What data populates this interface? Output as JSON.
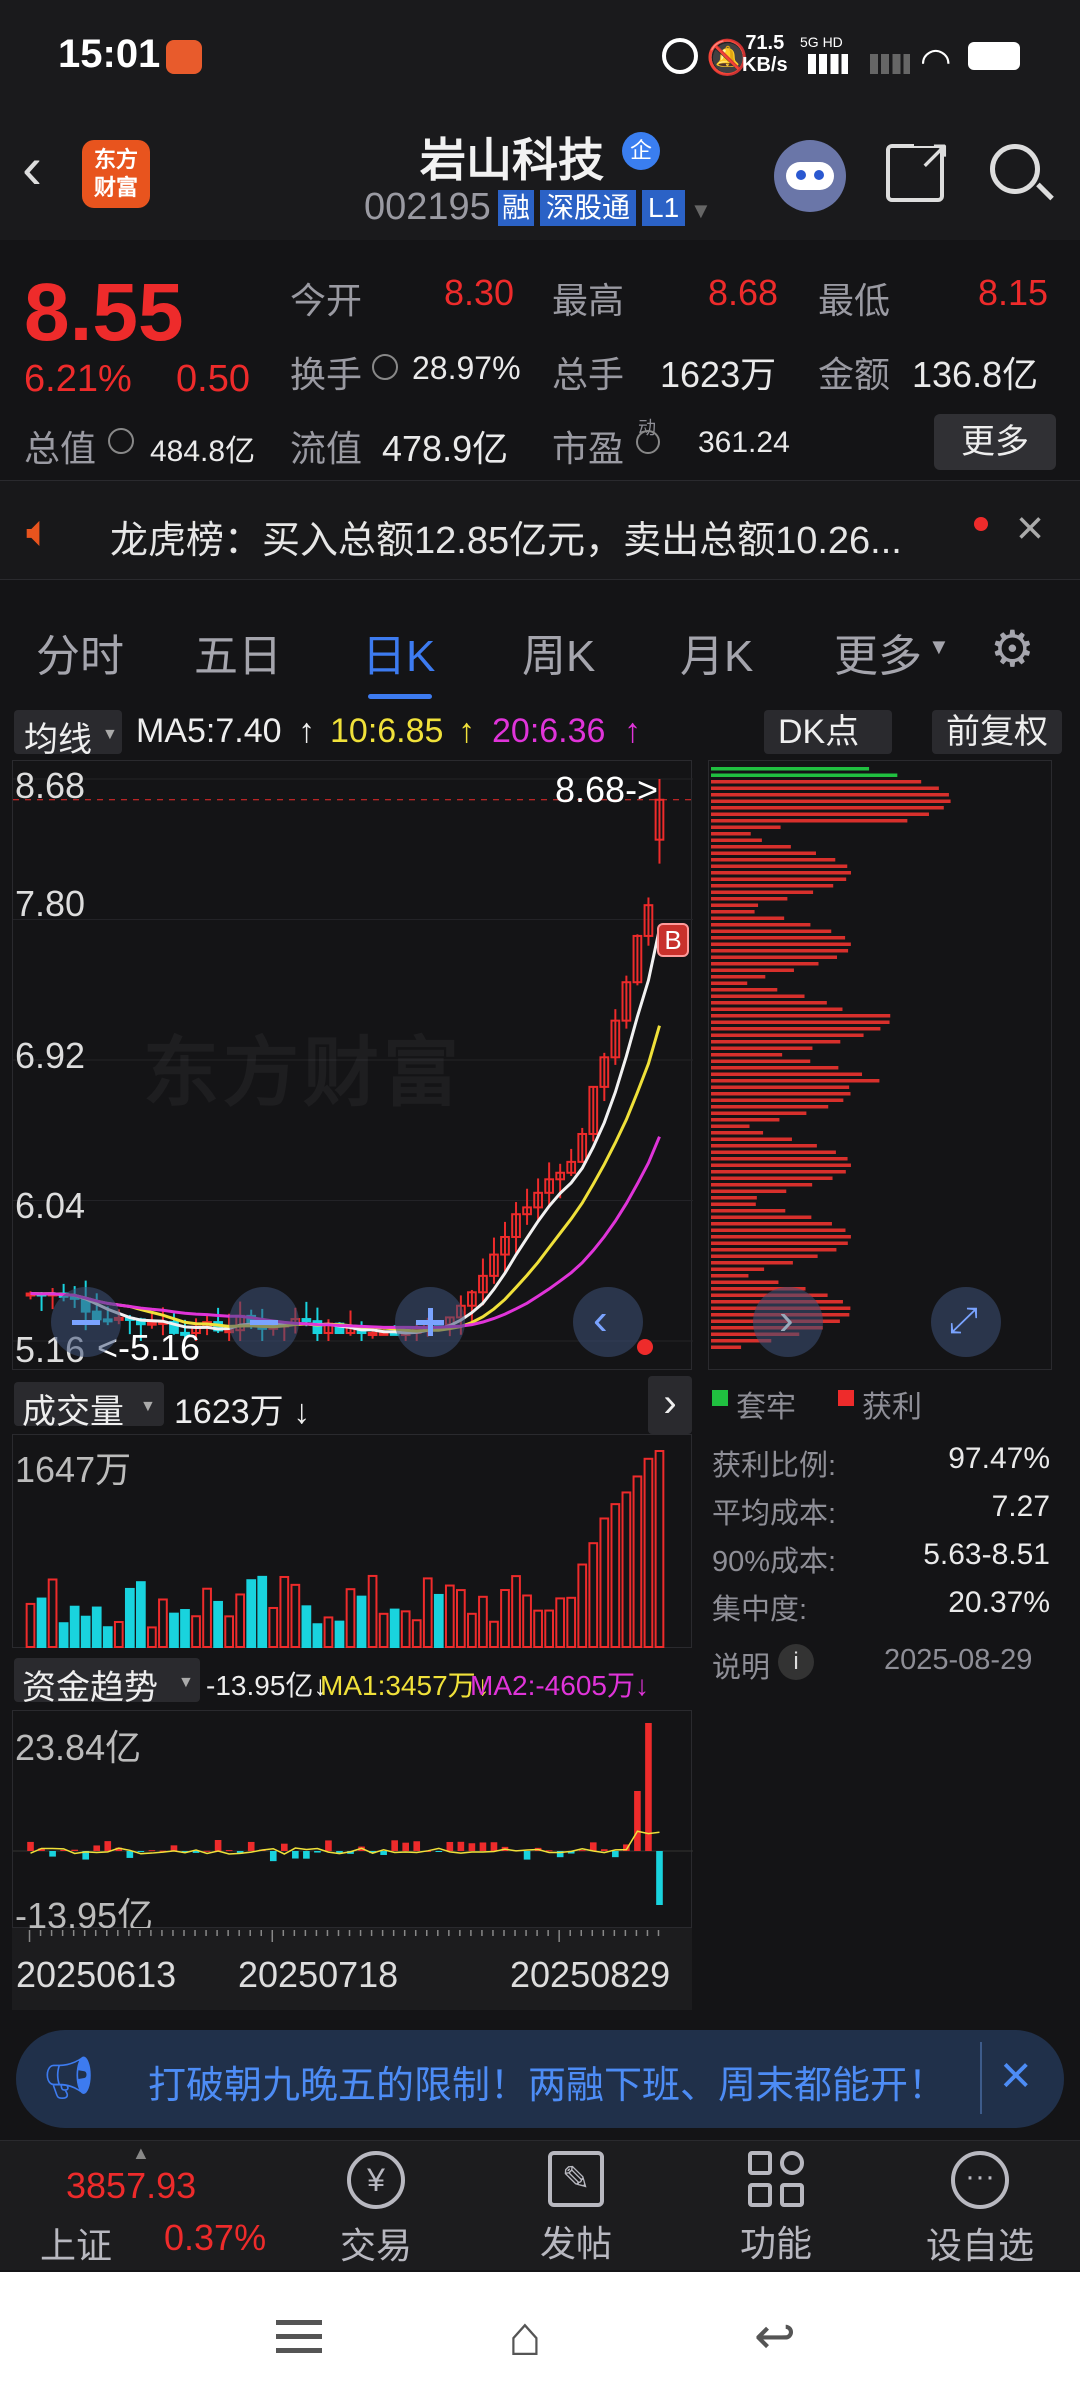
{
  "status": {
    "time": "15:01",
    "speed_value": "71.5",
    "speed_unit": "KB/s",
    "net": "5G HD"
  },
  "header": {
    "logo_line1": "东方",
    "logo_line2": "财富",
    "title": "岩山科技",
    "badge": "企",
    "code": "002195",
    "tags": [
      "融",
      "深股通",
      "L1"
    ]
  },
  "quote": {
    "price": "8.55",
    "change_pct": "6.21%",
    "change": "0.50",
    "open_label": "今开",
    "open": "8.30",
    "high_label": "最高",
    "high": "8.68",
    "low_label": "最低",
    "low": "8.15",
    "turnover_label": "换手",
    "turnover": "28.97%",
    "volume_label": "总手",
    "volume": "1623万",
    "amount_label": "金额",
    "amount": "136.8亿",
    "mcap_label": "总值",
    "mcap": "484.8亿",
    "float_label": "流值",
    "float": "478.9亿",
    "pe_label": "市盈",
    "pe_sup": "动",
    "pe": "361.24",
    "more": "更多"
  },
  "notice": {
    "text": "龙虎榜：买入总额12.85亿元，卖出总额10.26..."
  },
  "tabs": [
    "分时",
    "五日",
    "日K",
    "周K",
    "月K",
    "更多"
  ],
  "active_tab": "日K",
  "ma": {
    "selector": "均线",
    "ma5": "MA5:7.40",
    "ma10": "10:6.85",
    "ma20": "20:6.36",
    "up": "↑"
  },
  "dk_button": "DK点",
  "adj_button": "前复权",
  "kline": {
    "y_labels": [
      "8.68",
      "7.80",
      "6.92",
      "6.04",
      "5.16"
    ],
    "high_note": "8.68->",
    "low_note": "<-5.16",
    "watermark": "东方财富",
    "b_marker": "B"
  },
  "volume": {
    "selector": "成交量",
    "value": "1623万 ↓",
    "max": "1647万"
  },
  "fund": {
    "selector": "资金趋势",
    "value": "-13.95亿↓",
    "ma1": "MA1:3457万↓",
    "ma2": "MA2:-4605万↓",
    "max": "23.84亿",
    "min": "-13.95亿"
  },
  "dates": [
    "20250613",
    "20250718",
    "20250829"
  ],
  "chips": {
    "legend_trap": "套牢",
    "legend_profit": "获利",
    "rows": [
      {
        "label": "获利比例:",
        "value": "97.47%"
      },
      {
        "label": "平均成本:",
        "value": "7.27"
      },
      {
        "label": "90%成本:",
        "value": "5.63-8.51"
      },
      {
        "label": "集中度:",
        "value": "20.37%"
      }
    ],
    "note_label": "说明",
    "date": "2025-08-29"
  },
  "banner": {
    "text": "打破朝九晚五的限制！两融下班、周末都能开！"
  },
  "bottomnav": {
    "index_value": "3857.93",
    "index_name": "上证",
    "index_pct": "0.37%",
    "items": [
      "交易",
      "发帖",
      "功能",
      "设自选"
    ]
  },
  "chart_data": {
    "type": "candlestick",
    "title": "日K",
    "ylim": [
      5.16,
      8.68
    ],
    "x_ticks": [
      "20250613",
      "20250718",
      "20250829"
    ],
    "last_candle": {
      "open": 8.3,
      "high": 8.68,
      "low": 8.15,
      "close": 8.55
    },
    "ma": {
      "MA5": 7.4,
      "MA10": 6.85,
      "MA20": 6.36
    },
    "volume_max": "1647万",
    "volume_last": "1623万",
    "fund_range": [
      "-13.95亿",
      "23.84亿"
    ]
  }
}
